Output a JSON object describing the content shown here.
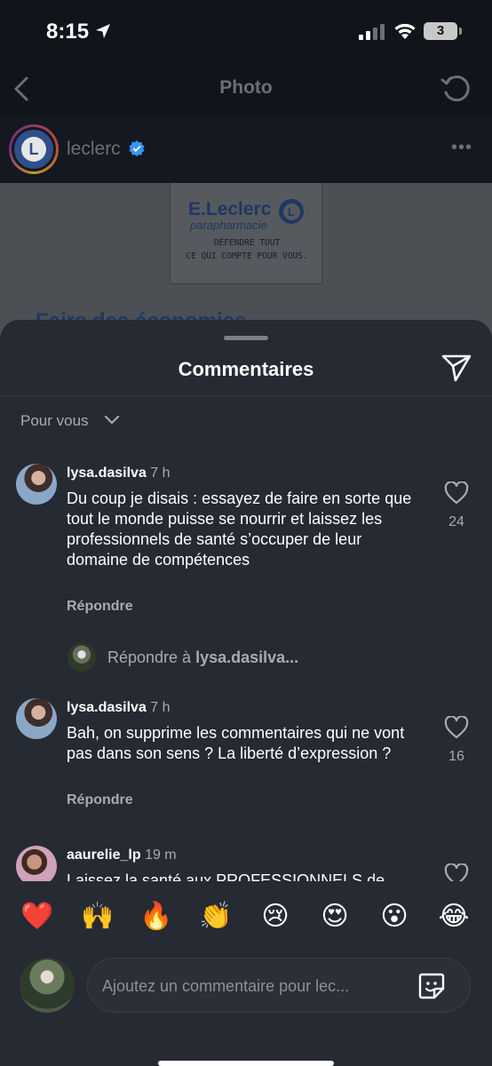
{
  "status_bar": {
    "time": "8:15",
    "battery": "3"
  },
  "header": {
    "title": "Photo",
    "account": "leclerc"
  },
  "post_image": {
    "brand": "E.Leclerc",
    "brand_sub": "parapharmacie",
    "brand_logo_letter": "L",
    "tagline_1": "DÉFENDRE TOUT",
    "tagline_2": "CE QUI COMPTE POUR VOUS.",
    "headline": "Faire des économies"
  },
  "sheet": {
    "title": "Commentaires",
    "sort_label": "Pour vous"
  },
  "comments": [
    {
      "user": "lysa.dasilva",
      "time": "7 h",
      "text": "Du coup je disais : essayez de faire en sorte que tout le monde puisse se nourrir et laissez les professionnels de santé s’occuper de leur domaine de compétences",
      "reply_label": "Répondre",
      "likes": "24"
    },
    {
      "user": "lysa.dasilva",
      "time": "7 h",
      "text": "Bah, on supprime les commentaires qui ne vont pas dans son sens ? La liberté d’expression ?",
      "reply_label": "Répondre",
      "likes": "16"
    },
    {
      "user": "aaurelie_lp",
      "time": "19 m",
      "text": "Laissez la santé aux PROFESSIONNELS de"
    }
  ],
  "reply_prompt": {
    "prefix": "Répondre à",
    "target": "lysa.dasilva..."
  },
  "emoji_bar": [
    "❤️",
    "🙌",
    "🔥",
    "👏",
    "😢",
    "😍",
    "😮",
    "😂"
  ],
  "composer": {
    "placeholder": "Ajoutez un commentaire pour lec..."
  },
  "colors": {
    "sheet_bg": "#262a33",
    "screen_bg": "#0f1319",
    "verified_blue": "#3797f0"
  }
}
